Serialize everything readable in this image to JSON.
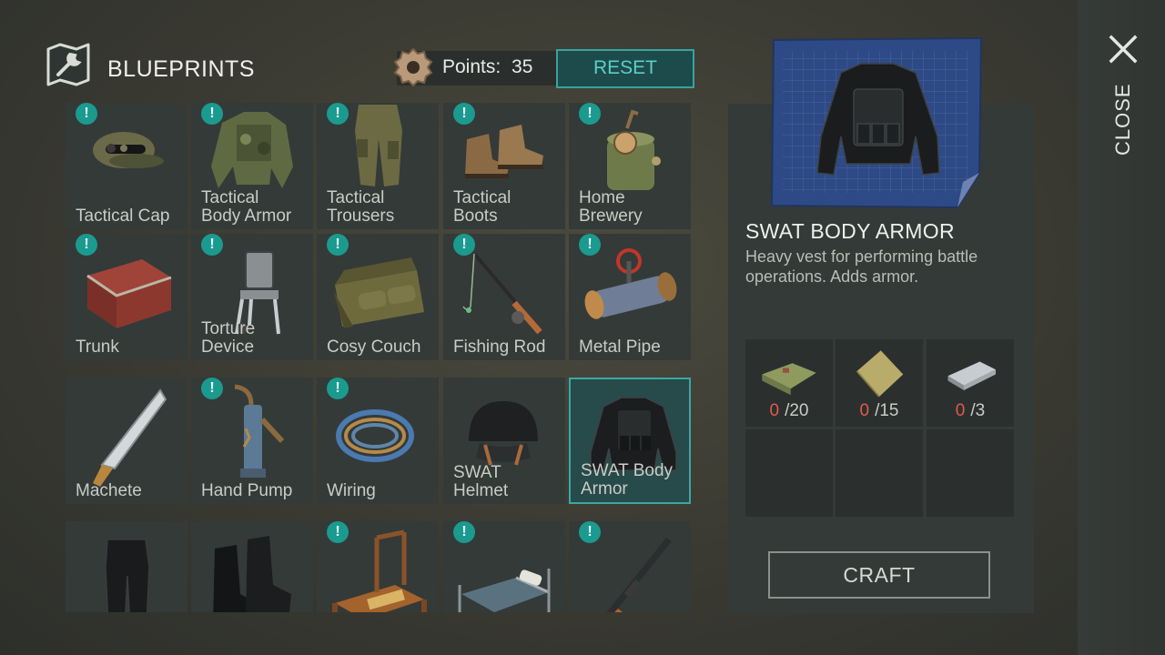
{
  "header": {
    "title": "BLUEPRINTS",
    "points_label": "Points:",
    "points_value": "35",
    "reset_label": "RESET"
  },
  "close_label": "CLOSE",
  "grid": [
    {
      "label": "Tactical Cap",
      "badge": true,
      "selected": false,
      "icon": "tactical-cap-icon"
    },
    {
      "label": "Tactical\nBody Armor",
      "badge": true,
      "selected": false,
      "icon": "tactical-body-armor-icon"
    },
    {
      "label": "Tactical\nTrousers",
      "badge": true,
      "selected": false,
      "icon": "tactical-trousers-icon"
    },
    {
      "label": "Tactical\nBoots",
      "badge": true,
      "selected": false,
      "icon": "tactical-boots-icon"
    },
    {
      "label": "Home\nBrewery",
      "badge": true,
      "selected": false,
      "icon": "home-brewery-icon"
    },
    {
      "label": "Trunk",
      "badge": true,
      "selected": false,
      "icon": "trunk-icon"
    },
    {
      "label": "Torture\nDevice",
      "badge": true,
      "selected": false,
      "icon": "torture-device-icon"
    },
    {
      "label": "Cosy Couch",
      "badge": true,
      "selected": false,
      "icon": "couch-icon"
    },
    {
      "label": "Fishing Rod",
      "badge": true,
      "selected": false,
      "icon": "fishing-rod-icon"
    },
    {
      "label": "Metal Pipe",
      "badge": true,
      "selected": false,
      "icon": "metal-pipe-icon"
    },
    {
      "label": "Machete",
      "badge": false,
      "selected": false,
      "icon": "machete-icon"
    },
    {
      "label": "Hand Pump",
      "badge": true,
      "selected": false,
      "icon": "hand-pump-icon"
    },
    {
      "label": "Wiring",
      "badge": true,
      "selected": false,
      "icon": "wiring-icon"
    },
    {
      "label": "SWAT\nHelmet",
      "badge": false,
      "selected": false,
      "icon": "swat-helmet-icon"
    },
    {
      "label": "SWAT Body\nArmor",
      "badge": false,
      "selected": true,
      "icon": "swat-body-armor-icon"
    },
    {
      "label": "",
      "badge": false,
      "selected": false,
      "icon": "swat-trousers-icon"
    },
    {
      "label": "",
      "badge": false,
      "selected": false,
      "icon": "swat-boots-icon"
    },
    {
      "label": "",
      "badge": true,
      "selected": false,
      "icon": "workbench-icon"
    },
    {
      "label": "",
      "badge": true,
      "selected": false,
      "icon": "bed-icon"
    },
    {
      "label": "",
      "badge": true,
      "selected": false,
      "icon": "rifle-icon"
    }
  ],
  "detail": {
    "name": "SWAT BODY ARMOR",
    "description": "Heavy vest for performing battle operations. Adds armor.",
    "requirements": [
      {
        "icon": "fabric-icon",
        "have": "0",
        "need": "/20"
      },
      {
        "icon": "burlap-icon",
        "have": "0",
        "need": "/15"
      },
      {
        "icon": "steel-ingot-icon",
        "have": "0",
        "need": "/3"
      },
      {
        "icon": "",
        "have": "",
        "need": ""
      },
      {
        "icon": "",
        "have": "",
        "need": ""
      },
      {
        "icon": "",
        "have": "",
        "need": ""
      }
    ],
    "craft_label": "CRAFT"
  },
  "colors": {
    "accent": "#37a39f",
    "missing_qty": "#e05a4a",
    "cell_bg": "#343a38"
  }
}
